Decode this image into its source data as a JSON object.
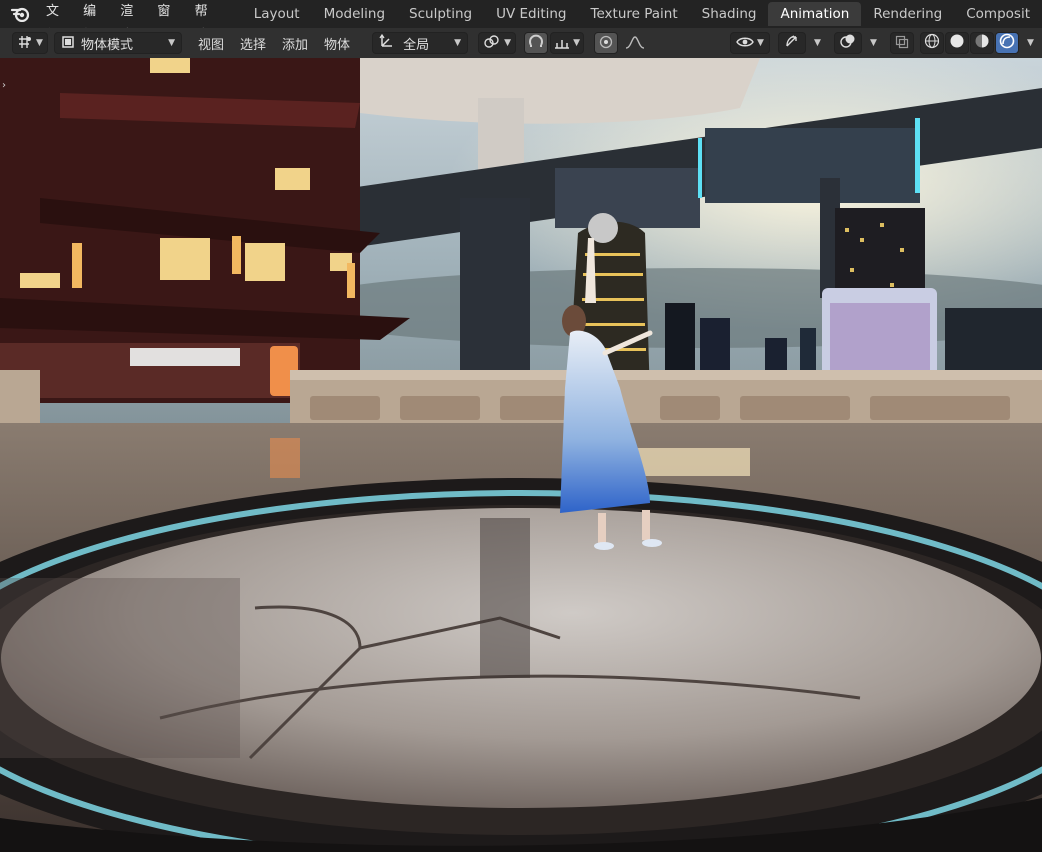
{
  "menu": {
    "items": [
      "文件",
      "编辑",
      "渲染",
      "窗口",
      "帮助"
    ]
  },
  "workspace_tabs": {
    "items": [
      "Layout",
      "Modeling",
      "Sculpting",
      "UV Editing",
      "Texture Paint",
      "Shading",
      "Animation",
      "Rendering",
      "Composit"
    ],
    "active": "Animation"
  },
  "toolbar": {
    "mode_label": "物体模式",
    "view_label": "视图",
    "select_label": "选择",
    "add_label": "添加",
    "object_label": "物体",
    "transform_orientation": "全局"
  },
  "icons": {
    "logo": "blender-logo-icon",
    "editor_type": "editor-type-icon",
    "mode": "object-mode-icon",
    "orientation": "transform-orientation-icon",
    "pivot": "pivot-point-icon",
    "snap": "snap-magnet-icon",
    "snap_target": "snap-target-icon",
    "proportional": "proportional-edit-icon",
    "falloff": "falloff-curve-icon",
    "visibility": "visibility-eye-icon",
    "gizmo": "gizmo-icon",
    "overlay": "overlay-icon",
    "xray": "xray-icon",
    "shading_wire": "wireframe-shading-icon",
    "shading_solid": "solid-shading-icon",
    "shading_material": "material-shading-icon",
    "shading_rendered": "rendered-shading-icon"
  },
  "colors": {
    "accent": "#4772b3",
    "header_bg": "#232323",
    "toolbar_bg": "#303030"
  }
}
